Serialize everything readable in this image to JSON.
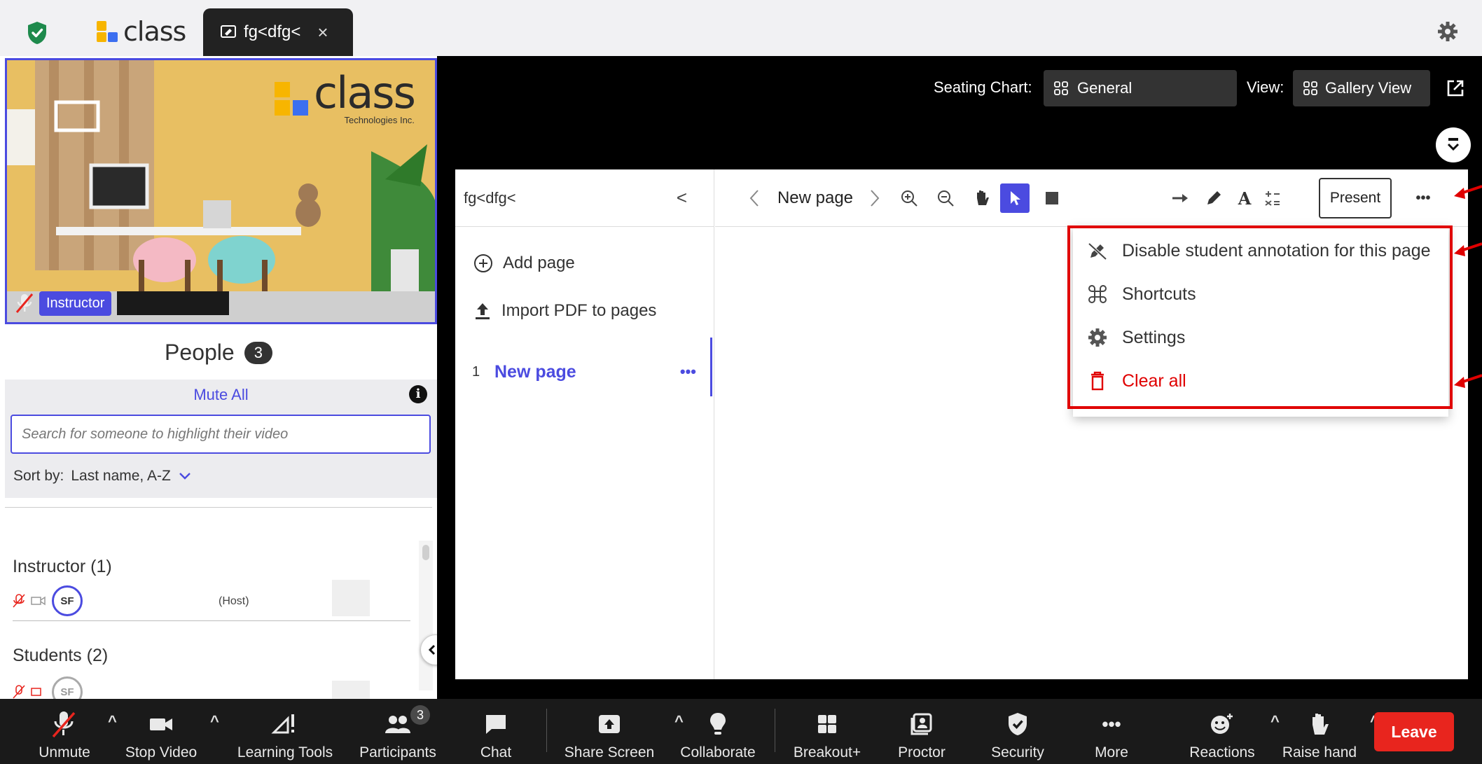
{
  "topbar": {
    "brand": "class",
    "tab_title": "fg<dfg<",
    "tab_close": "×"
  },
  "video": {
    "logo_text": "class",
    "logo_sub": "Technologies Inc.",
    "instructor_label": "Instructor"
  },
  "people": {
    "title": "People",
    "count": "3",
    "mute_all": "Mute All",
    "info": "i",
    "search_placeholder": "Search for someone to highlight their video",
    "sort_label": "Sort by:",
    "sort_value": "Last name, A-Z",
    "instructor_group": "Instructor (1)",
    "instructor_initials": "SF",
    "host_tag": "(Host)",
    "students_group": "Students (2)",
    "student_initials": "SF"
  },
  "header": {
    "seating_label": "Seating Chart:",
    "seating_value": "General",
    "view_label": "View:",
    "view_value": "Gallery View"
  },
  "whiteboard": {
    "title": "fg<dfg<",
    "back": "<",
    "add_page": "Add page",
    "import_pdf": "Import PDF to pages",
    "pages": [
      {
        "num": "1",
        "name": "New page"
      }
    ],
    "page_more": "•••",
    "current_page": "New page",
    "present": "Present",
    "more": "•••"
  },
  "menu": {
    "items": [
      {
        "label": "Disable student annotation for this page",
        "icon": "pencil-off-icon"
      },
      {
        "label": "Shortcuts",
        "icon": "command-icon"
      },
      {
        "label": "Settings",
        "icon": "gear-icon"
      },
      {
        "label": "Clear all",
        "icon": "trash-icon",
        "color": "#e00000"
      }
    ]
  },
  "bottombar": {
    "unmute": "Unmute",
    "stop_video": "Stop Video",
    "learning_tools": "Learning Tools",
    "participants": "Participants",
    "participants_count": "3",
    "chat": "Chat",
    "share_screen": "Share Screen",
    "collaborate": "Collaborate",
    "breakout": "Breakout+",
    "proctor": "Proctor",
    "security": "Security",
    "more": "More",
    "reactions": "Reactions",
    "raise_hand": "Raise hand",
    "leave": "Leave"
  },
  "colors": {
    "accent": "#4b4be0",
    "danger": "#e00000",
    "leave": "#e8251e",
    "shield": "#1e8a4c"
  }
}
